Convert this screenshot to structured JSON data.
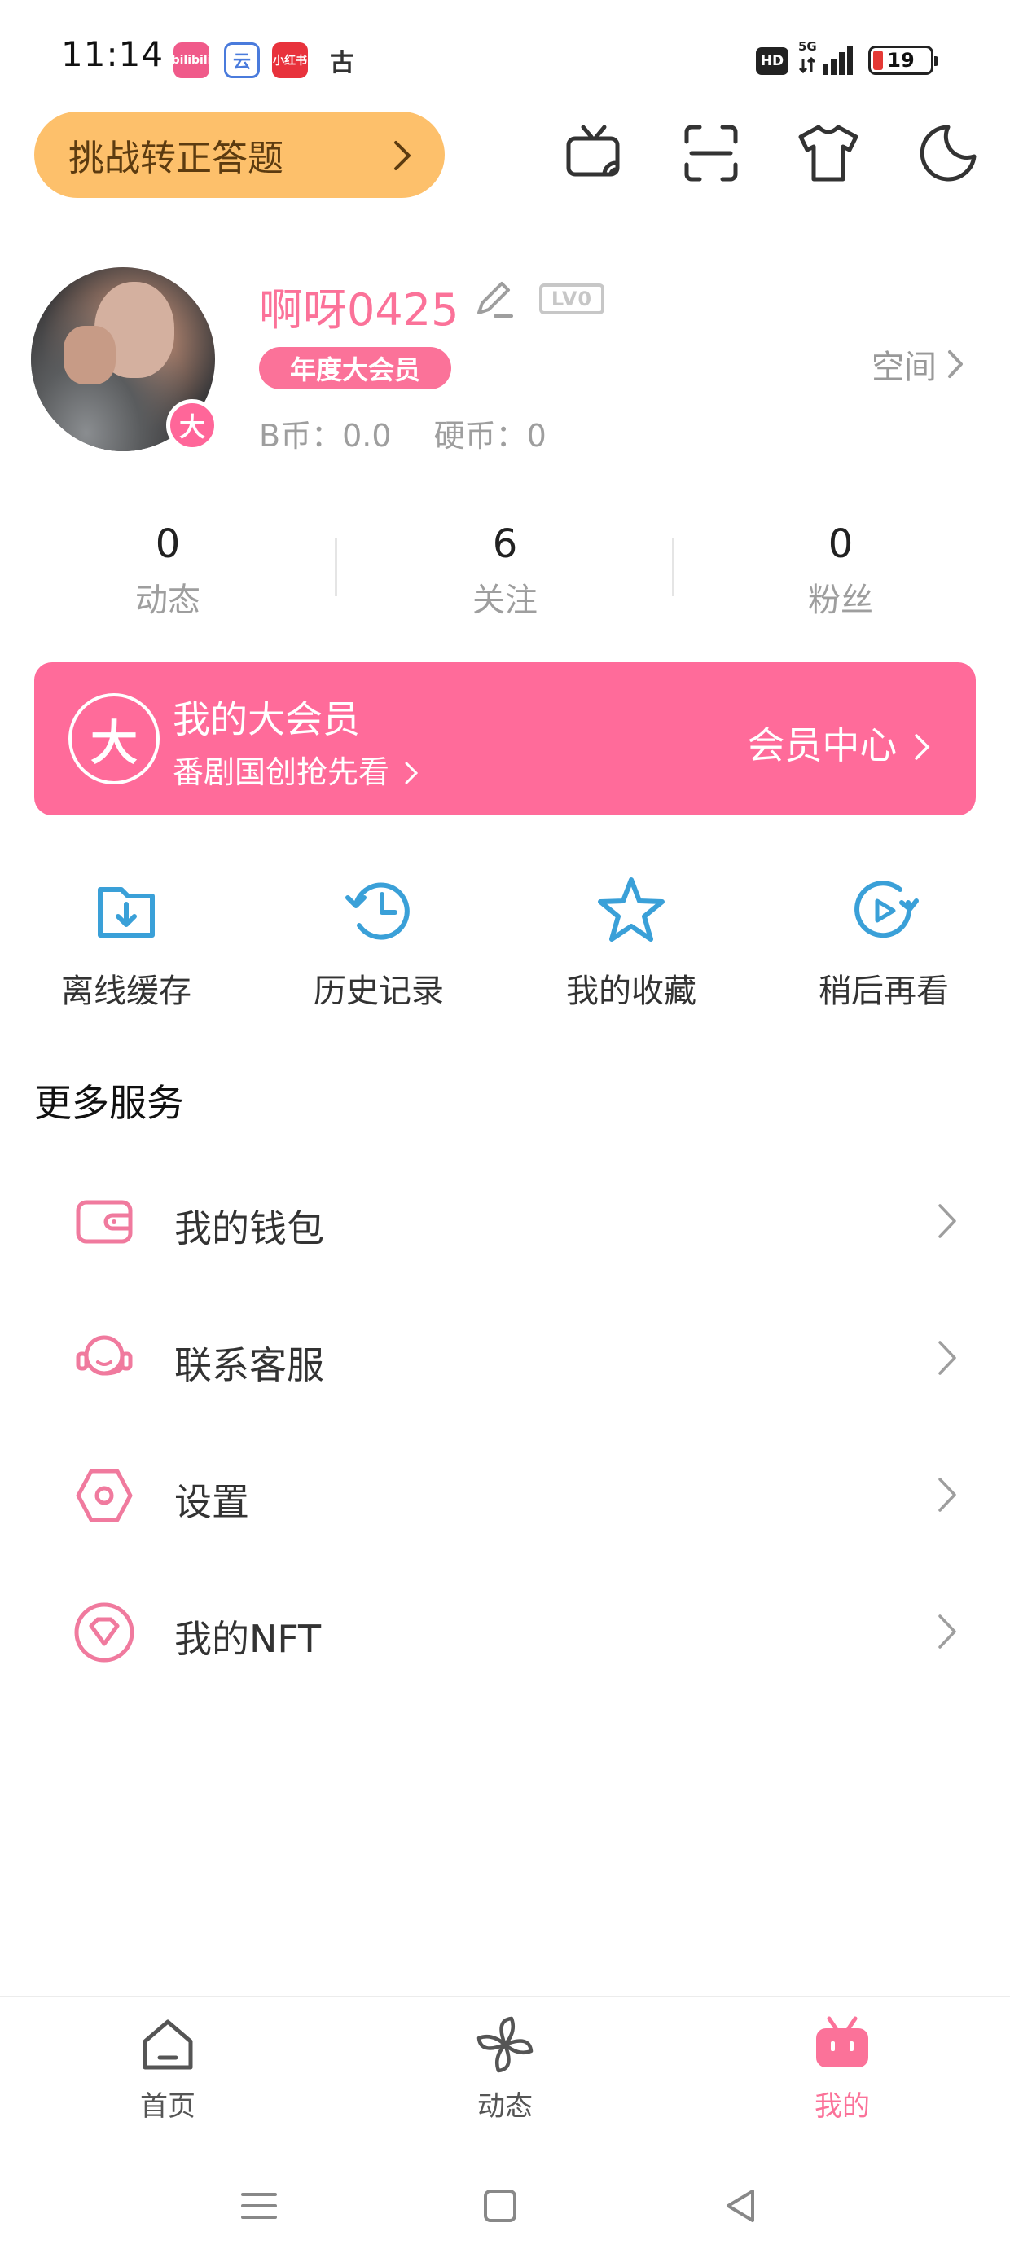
{
  "status_bar": {
    "time": "11:14",
    "notification_apps": [
      "bilibili",
      "云",
      "小红书",
      "古"
    ],
    "hd": "HD",
    "network": "5G",
    "battery": "19"
  },
  "top_bar": {
    "challenge_label": "挑战转正答题",
    "icons": [
      "tv-cast-icon",
      "scan-icon",
      "tshirt-icon",
      "moon-icon"
    ]
  },
  "profile": {
    "username": "啊呀0425",
    "level": "LV0",
    "vip_badge": "年度大会员",
    "vip_dot": "大",
    "coins_label": "B币：0.0",
    "hard_coins_label": "硬币：0",
    "space_link": "空间"
  },
  "stats": [
    {
      "value": "0",
      "label": "动态"
    },
    {
      "value": "6",
      "label": "关注"
    },
    {
      "value": "0",
      "label": "粉丝"
    }
  ],
  "vip_banner": {
    "emblem": "大",
    "title": "我的大会员",
    "subtitle": "番剧国创抢先看",
    "center_link": "会员中心"
  },
  "quick_actions": [
    {
      "label": "离线缓存",
      "icon": "download-folder-icon"
    },
    {
      "label": "历史记录",
      "icon": "history-clock-icon"
    },
    {
      "label": "我的收藏",
      "icon": "star-icon"
    },
    {
      "label": "稍后再看",
      "icon": "watch-later-icon"
    }
  ],
  "more_services": {
    "title": "更多服务",
    "items": [
      {
        "label": "我的钱包",
        "icon": "wallet-icon"
      },
      {
        "label": "联系客服",
        "icon": "headset-icon"
      },
      {
        "label": "设置",
        "icon": "settings-hexagon-icon"
      },
      {
        "label": "我的NFT",
        "icon": "diamond-icon"
      }
    ]
  },
  "bottom_nav": [
    {
      "label": "首页",
      "icon": "home-icon",
      "active": false
    },
    {
      "label": "动态",
      "icon": "pinwheel-icon",
      "active": false
    },
    {
      "label": "我的",
      "icon": "bilibili-tv-icon",
      "active": true
    }
  ],
  "colors": {
    "brand_pink": "#fb7299",
    "banner_pink": "#ff6b9a",
    "challenge_yellow": "#fdc06b",
    "quick_blue": "#3aa0d8"
  }
}
